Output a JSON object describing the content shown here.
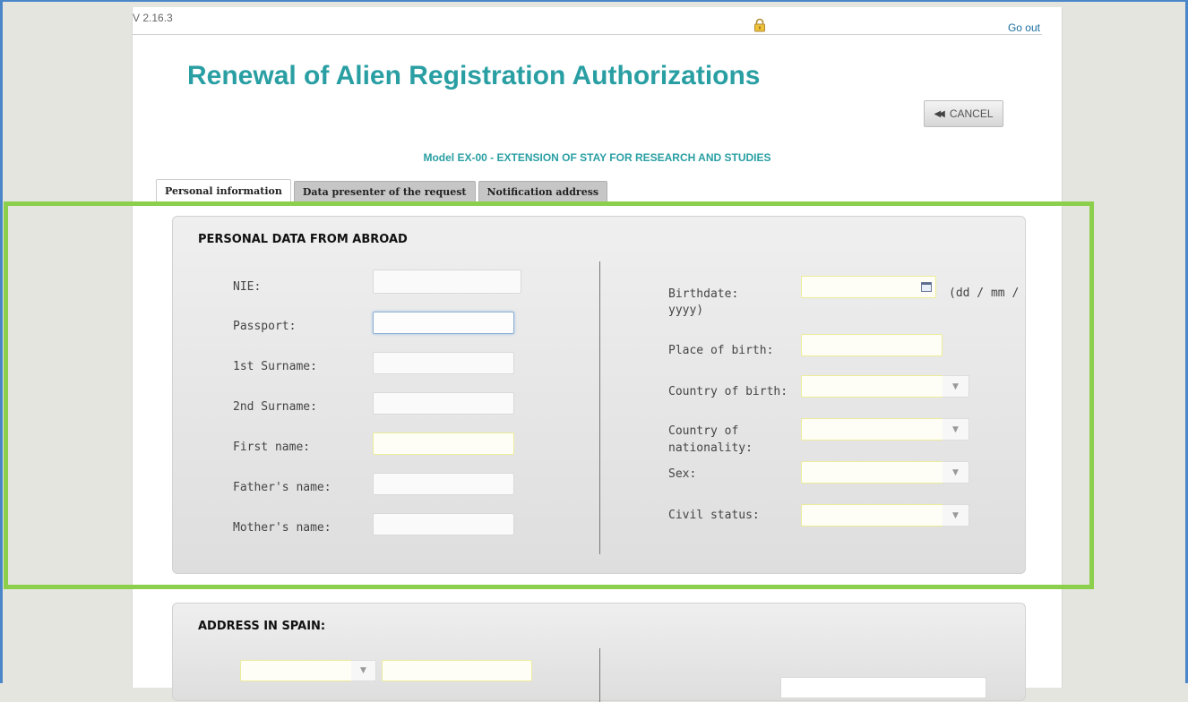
{
  "header": {
    "version": "V 2.16.3",
    "lock_icon": "lock-icon",
    "go_out_label": "Go out"
  },
  "title": "Renewal of Alien Registration Authorizations",
  "cancel_button": {
    "icon": "double-chevron-left-icon",
    "label": "CANCEL"
  },
  "subtitle": "Model EX-00 - EXTENSION OF STAY FOR RESEARCH AND STUDIES",
  "tabs": [
    {
      "label": "Personal information",
      "active": true
    },
    {
      "label": "Data presenter of the request",
      "active": false
    },
    {
      "label": "Notification address",
      "active": false
    }
  ],
  "personal_data": {
    "heading": "PERSONAL DATA FROM ABROAD",
    "left_fields": [
      {
        "label": "NIE:",
        "value": ""
      },
      {
        "label": "Passport:",
        "value": ""
      },
      {
        "label": "1st Surname:",
        "value": ""
      },
      {
        "label": "2nd Surname:",
        "value": ""
      },
      {
        "label": "First name:",
        "value": ""
      },
      {
        "label": "Father's name:",
        "value": ""
      },
      {
        "label": "Mother's name:",
        "value": ""
      }
    ],
    "birthdate": {
      "label": "Birthdate:",
      "hint_part1": "(dd / mm /",
      "hint_part2": "yyyy)",
      "value": ""
    },
    "place_of_birth": {
      "label": "Place of birth:",
      "value": ""
    },
    "country_of_birth": {
      "label": "Country of birth:",
      "value": ""
    },
    "country_of_nationality": {
      "label_line1": "Country of",
      "label_line2": "nationality:",
      "value": ""
    },
    "sex": {
      "label": "Sex:",
      "value": ""
    },
    "civil_status": {
      "label": "Civil status:",
      "value": ""
    }
  },
  "address": {
    "heading": "ADDRESS IN SPAIN:"
  },
  "colors": {
    "accent": "#2a9fa3",
    "highlight": "#8bcf4c",
    "window_frame": "#4a86c8"
  }
}
